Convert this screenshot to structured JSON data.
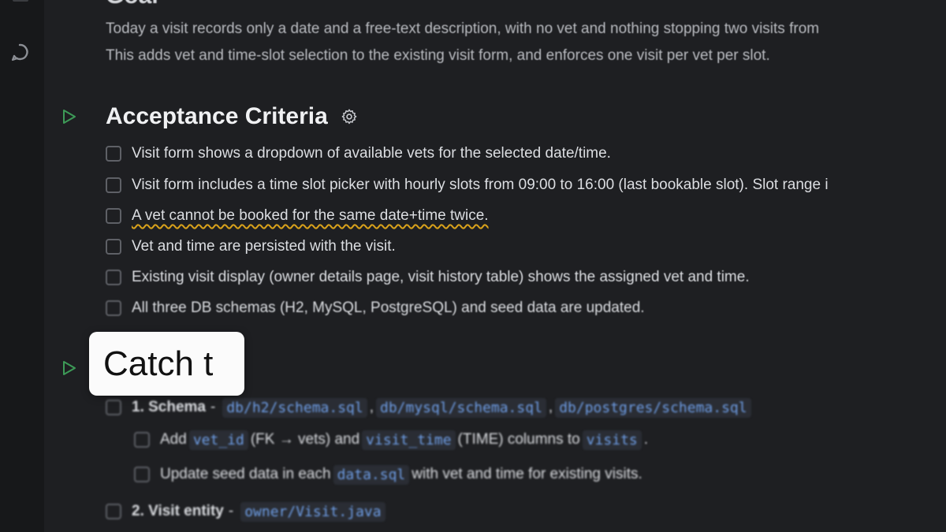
{
  "goal": {
    "title": "Goal",
    "line1": "Today a visit records only a date and a free-text description, with no vet and nothing stopping two visits from",
    "line2": "This adds vet and time-slot selection to the existing visit form, and enforces one visit per vet per slot."
  },
  "acceptance": {
    "title": "Acceptance Criteria",
    "items": [
      "Visit form shows a dropdown of available vets for the selected date/time.",
      "Visit form includes a time slot picker with hourly slots from 09:00 to 16:00 (last bookable slot). Slot range i",
      "A vet cannot be booked for the same date+time twice.",
      "Vet and time are persisted with the visit.",
      "Existing visit display (owner details page, visit history table) shows the assigned vet and time.",
      "All three DB schemas (H2, MySQL, PostgreSQL) and seed data are updated."
    ]
  },
  "tasks": {
    "schema_label": "1. Schema",
    "separator": "-",
    "schema_files": [
      "db/h2/schema.sql",
      "db/mysql/schema.sql",
      "db/postgres/schema.sql"
    ],
    "comma": ",",
    "sub1_a": "Add",
    "sub1_code1": "vet_id",
    "sub1_b": "(FK → vets) and",
    "sub1_code2": "visit_time",
    "sub1_c": "(TIME) columns to",
    "sub1_code3": "visits",
    "sub1_d": ".",
    "sub2_a": "Update seed data in each",
    "sub2_code": "data.sql",
    "sub2_b": "with vet and time for existing visits.",
    "entity_label": "2. Visit entity",
    "entity_file": "owner/Visit.java"
  },
  "callout": {
    "text": "Catch t"
  },
  "colors": {
    "accent_run": "#3d9a57",
    "squiggle": "#d9a21b",
    "code": "#6f9fe8"
  }
}
